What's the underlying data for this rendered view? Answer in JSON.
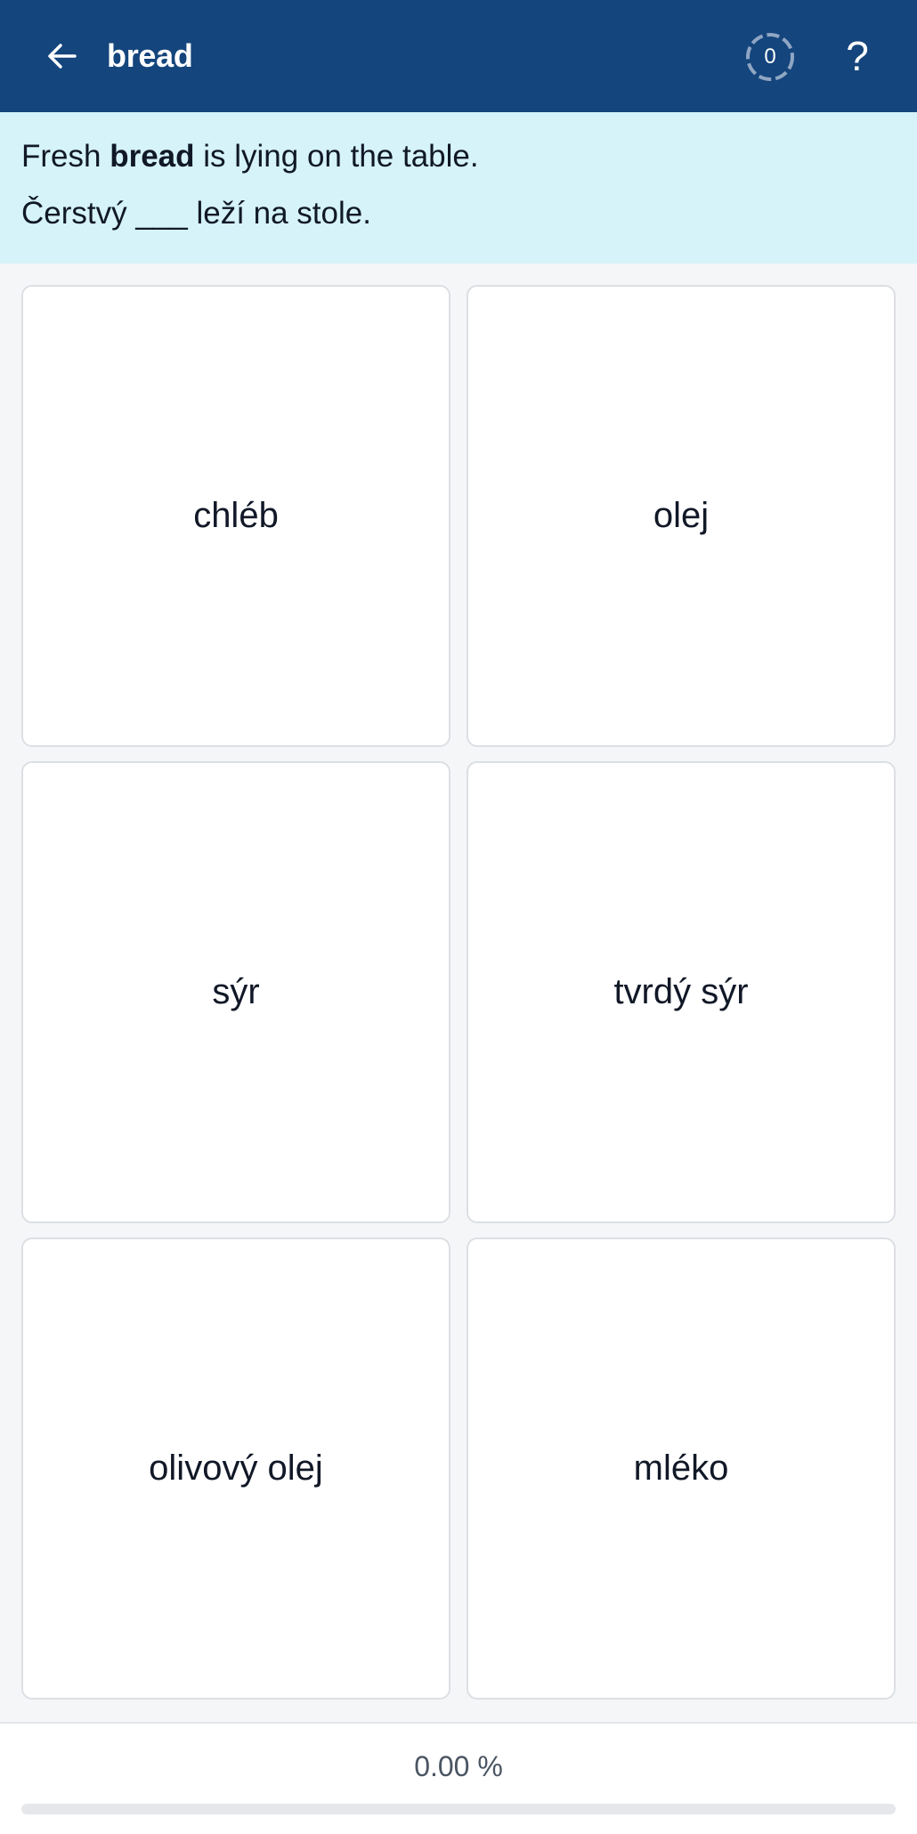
{
  "header": {
    "title": "bread",
    "back_icon": "arrow-left-icon",
    "score": "0",
    "help_label": "?"
  },
  "prompt": {
    "english": {
      "before": "Fresh ",
      "highlight": "bread",
      "after": " is lying on the table."
    },
    "czech": "Čerstvý ___ leží na stole."
  },
  "options": [
    {
      "label": "chléb"
    },
    {
      "label": "olej"
    },
    {
      "label": "sýr"
    },
    {
      "label": "tvrdý sýr"
    },
    {
      "label": "olivový olej"
    },
    {
      "label": "mléko"
    }
  ],
  "progress": {
    "text": "0.00 %",
    "fraction": 0
  },
  "colors": {
    "header_bg": "#14457c",
    "prompt_bg": "#d5f3f8",
    "page_bg": "#f5f6f8"
  }
}
